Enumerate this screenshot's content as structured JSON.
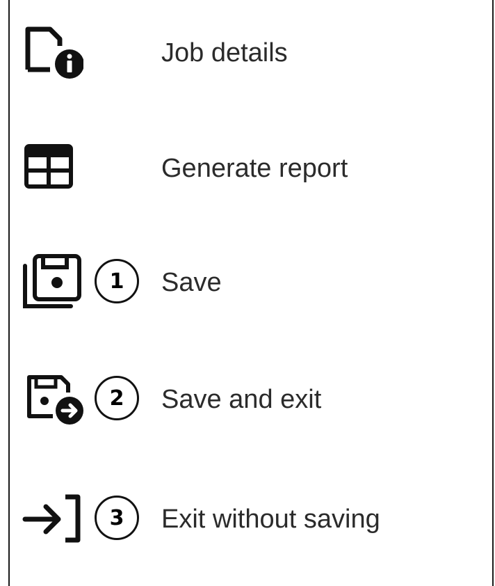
{
  "menu": {
    "items": [
      {
        "label": "Job details",
        "icon": "file-info-icon",
        "callout": ""
      },
      {
        "label": "Generate report",
        "icon": "table-icon",
        "callout": ""
      },
      {
        "label": "Save",
        "icon": "save-copy-icon",
        "callout": "1"
      },
      {
        "label": "Save and exit",
        "icon": "save-exit-icon",
        "callout": "2"
      },
      {
        "label": "Exit without saving",
        "icon": "exit-icon",
        "callout": "3"
      }
    ]
  },
  "colors": {
    "icon": "#111111",
    "text": "#2b2b2b",
    "border": "#1a1a1a"
  }
}
